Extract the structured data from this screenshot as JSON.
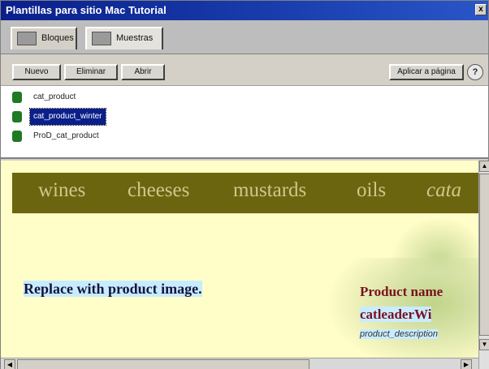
{
  "window": {
    "title": "Plantillas para sitio Mac Tutorial",
    "close_label": "x"
  },
  "tabs": [
    {
      "label": "Bloques",
      "active": false,
      "icon": "blocks-icon"
    },
    {
      "label": "Muestras",
      "active": true,
      "icon": "samples-icon"
    }
  ],
  "toolbar": {
    "new_label": "Nuevo",
    "delete_label": "Eliminar",
    "edit_label": "Abrir",
    "apply_label": "Aplicar a página",
    "help_label": "?"
  },
  "templates": [
    {
      "label": "cat_product",
      "selected": false
    },
    {
      "label": "cat_product_winter",
      "selected": true
    },
    {
      "label": "ProD_cat_product",
      "selected": false
    }
  ],
  "preview": {
    "nav": [
      "wines",
      "cheeses",
      "mustards",
      "oils",
      "cata"
    ],
    "product_image_text": "Replace with product image.",
    "product_name": "Product name",
    "cat_leader": "catleaderWi",
    "product_description": "product_description"
  },
  "colors": {
    "titlebar": "#0a1f8a",
    "nav_background": "#6b6510",
    "preview_background": "#fffdc8",
    "highlight": "#c8ecff",
    "product_name_color": "#7a1020"
  }
}
